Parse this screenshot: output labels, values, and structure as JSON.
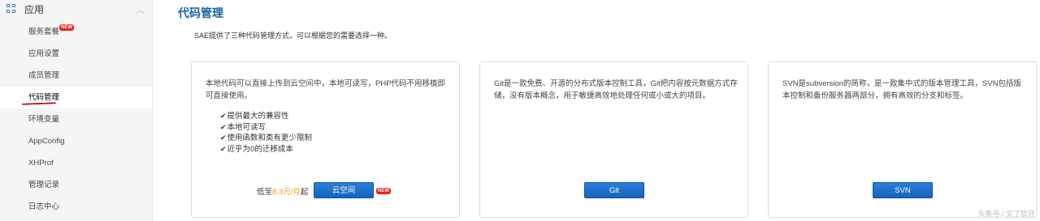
{
  "sidebar": {
    "section_title": "应用",
    "collapse_icon": "chevron-up-icon",
    "items": [
      {
        "label": "服务套餐",
        "badge": "NEW"
      },
      {
        "label": "应用设置"
      },
      {
        "label": "成员管理"
      },
      {
        "label": "代码管理",
        "active": true
      },
      {
        "label": "环境变量"
      },
      {
        "label": "AppConfig"
      },
      {
        "label": "XHProf"
      },
      {
        "label": "管理记录"
      },
      {
        "label": "日志中心"
      }
    ]
  },
  "main": {
    "title": "代码管理",
    "description": "SAE提供了三种代码管理方式，可以根据您的需要选择一种。",
    "cards": [
      {
        "description": "本地代码可以直接上传到云空间中，本地可读写，PHP代码不用移植即可直接使用。",
        "features": [
          "提供最大的兼容性",
          "本地可读写",
          "使用函数和类有更少限制",
          "近乎为0的迁移成本"
        ],
        "price_prefix": "低至",
        "price": "8.3元/月",
        "price_suffix": "起",
        "button_label": "云空间",
        "badge": "NEW"
      },
      {
        "description": "Git是一款免费、开源的分布式版本控制工具，Git把内容按元数据方式存储，没有版本概念，用于敏捷高效地处理任何或小或大的项目。",
        "button_label": "Git"
      },
      {
        "description": "SVN是subversion的简称，是一款集中式的版本管理工具，SVN包括版本控制和备份服务器两部分，拥有高效的分支和标签。",
        "button_label": "SVN"
      }
    ]
  },
  "watermark": "头条号 / 文了钦开",
  "colors": {
    "accent": "#1a62a5",
    "button": "#1a6fcc",
    "price": "#f39c12",
    "badge": "#e8201a"
  }
}
